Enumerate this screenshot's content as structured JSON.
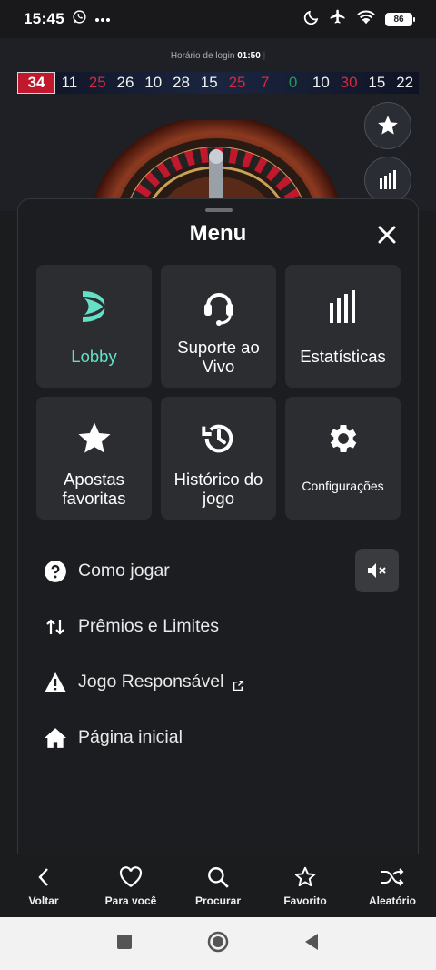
{
  "status_bar": {
    "time": "15:45",
    "battery": "86",
    "icons": [
      "whatsapp-icon",
      "more-icon",
      "moon-icon",
      "airplane-icon",
      "wifi-icon",
      "battery-icon"
    ]
  },
  "game": {
    "login_label": "Horário de login",
    "login_time": "01:50",
    "recent_numbers": [
      {
        "n": "34",
        "c": "first"
      },
      {
        "n": "11",
        "c": "black"
      },
      {
        "n": "25",
        "c": "red"
      },
      {
        "n": "26",
        "c": "black"
      },
      {
        "n": "10",
        "c": "black"
      },
      {
        "n": "28",
        "c": "black"
      },
      {
        "n": "15",
        "c": "black"
      },
      {
        "n": "25",
        "c": "red"
      },
      {
        "n": "7",
        "c": "red"
      },
      {
        "n": "0",
        "c": "green"
      },
      {
        "n": "10",
        "c": "black"
      },
      {
        "n": "30",
        "c": "red"
      },
      {
        "n": "15",
        "c": "black"
      },
      {
        "n": "22",
        "c": "black"
      }
    ]
  },
  "menu": {
    "title": "Menu",
    "tiles": [
      {
        "label": "Lobby",
        "icon": "lobby-logo-icon"
      },
      {
        "label": "Suporte ao Vivo",
        "icon": "headset-icon"
      },
      {
        "label": "Estatísticas",
        "icon": "statistics-icon"
      },
      {
        "label": "Apostas favoritas",
        "icon": "star-icon"
      },
      {
        "label": "Histórico do jogo",
        "icon": "history-icon"
      },
      {
        "label": "Configurações",
        "icon": "gear-icon"
      }
    ],
    "links": [
      {
        "label": "Como jogar",
        "icon": "help-icon"
      },
      {
        "label": "Prêmios e Limites",
        "icon": "swap-arrows-icon"
      },
      {
        "label": "Jogo Responsável",
        "icon": "warning-icon"
      },
      {
        "label": "Página inicial",
        "icon": "home-icon"
      }
    ]
  },
  "bottom_nav": [
    {
      "label": "Voltar",
      "icon": "back-icon"
    },
    {
      "label": "Para você",
      "icon": "heart-icon"
    },
    {
      "label": "Procurar",
      "icon": "search-icon"
    },
    {
      "label": "Favorito",
      "icon": "star-outline-icon"
    },
    {
      "label": "Aleatório",
      "icon": "shuffle-icon"
    }
  ],
  "colors": {
    "accent_teal": "#64e0c6",
    "tile_bg": "#2c2d31",
    "sheet_bg": "#1c1d20"
  }
}
